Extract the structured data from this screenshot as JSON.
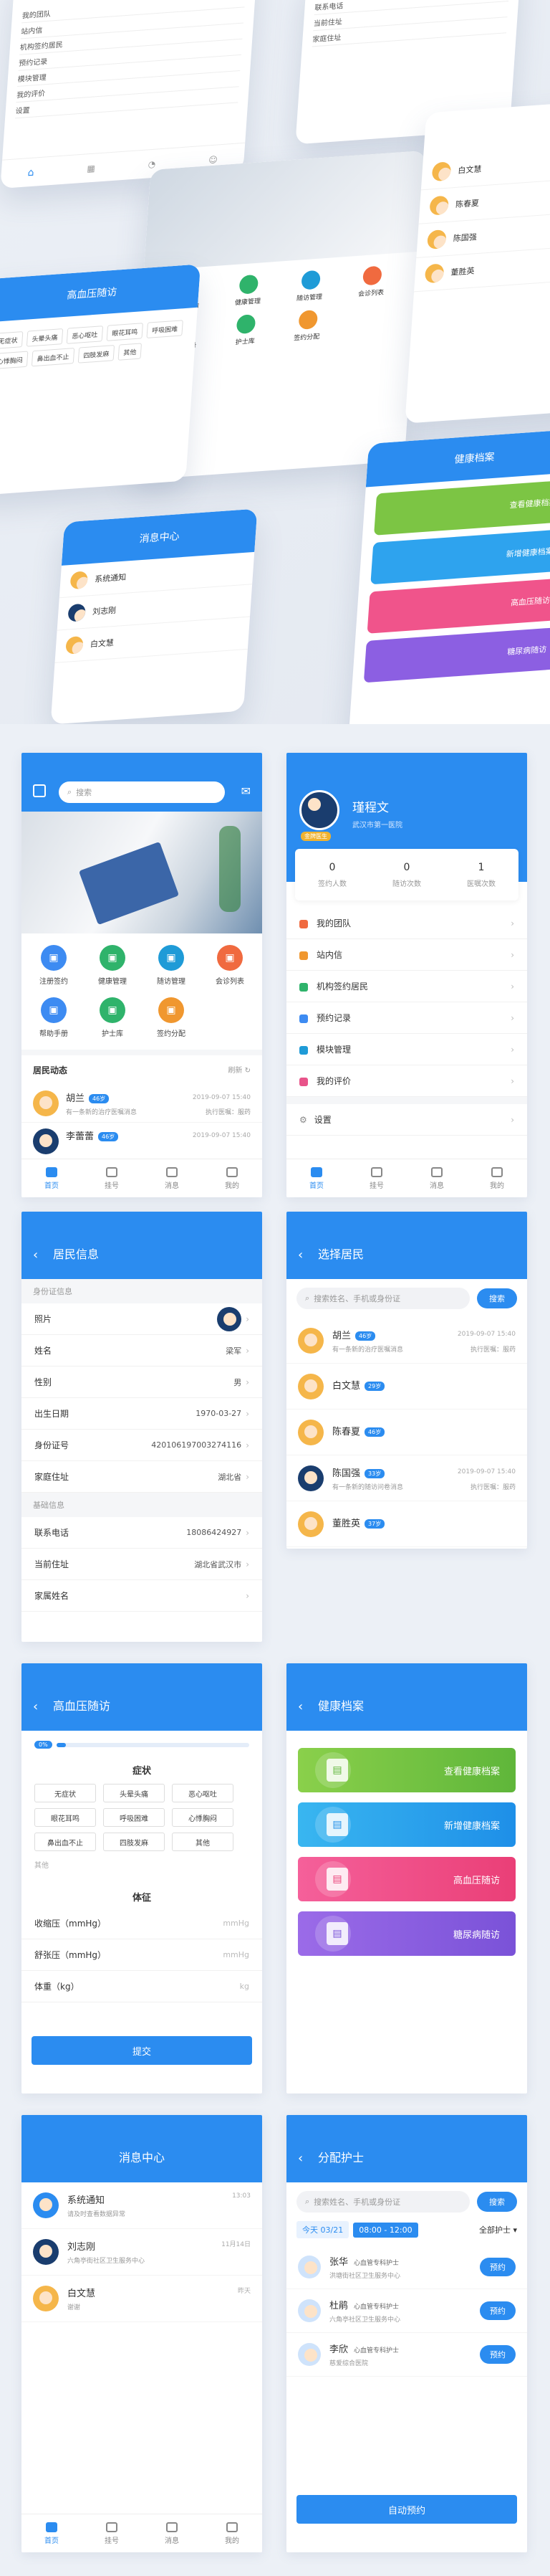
{
  "hero": {
    "a_menu": [
      "我的团队",
      "站内信",
      "机构签约居民",
      "预约记录",
      "模块管理",
      "我的评价",
      "设置"
    ],
    "b_rows": [
      "联系电话",
      "当前住址",
      "家庭住址"
    ],
    "b_phone": "18086424927",
    "c_items": [
      "注册签约",
      "健康管理",
      "随访管理",
      "会诊列表",
      "帮助手册",
      "护士库",
      "签约分配"
    ],
    "d_title": "消息中心",
    "d_msgs": [
      "系统通知",
      "刘志刚",
      "白文慧"
    ],
    "e_title": "健康档案",
    "e_cards": [
      "查看健康档案",
      "新增健康档案",
      "高血压随访",
      "糖尿病随访"
    ],
    "f_title": "高血压随访",
    "f_syms": [
      "无症状",
      "头晕头痛",
      "恶心呕吐",
      "眼花耳鸣",
      "呼吸困难",
      "心悸胸闷",
      "鼻出血不止",
      "四肢发麻",
      "其他"
    ],
    "g_names": [
      "白文慧",
      "陈春夏",
      "陈国强",
      "董胜英"
    ]
  },
  "home": {
    "search": "搜索",
    "grid": [
      {
        "label": "注册签约",
        "color": "#3d8bf2",
        "icon": "id-card-icon"
      },
      {
        "label": "健康管理",
        "color": "#2fb36b",
        "icon": "heart-icon"
      },
      {
        "label": "随访管理",
        "color": "#1f9bd7",
        "icon": "clipboard-icon"
      },
      {
        "label": "会诊列表",
        "color": "#f06a3f",
        "icon": "people-icon"
      },
      {
        "label": "帮助手册",
        "color": "#3d8bf2",
        "icon": "book-icon"
      },
      {
        "label": "护士库",
        "color": "#2fb36b",
        "icon": "nurse-icon"
      },
      {
        "label": "签约分配",
        "color": "#f0972f",
        "icon": "share-icon"
      }
    ],
    "news_title": "居民动态",
    "refresh": "刷新",
    "news": [
      {
        "name": "胡兰",
        "tag": "46岁",
        "time": "2019-09-07 15:40",
        "desc": "有一条新的治疗医嘱消息",
        "action": "执行医嘱：服药",
        "avatar": "f"
      },
      {
        "name": "李蕾蕾",
        "tag": "46岁",
        "time": "2019-09-07 15:40",
        "desc": "",
        "action": "",
        "avatar": "m"
      }
    ]
  },
  "tabs": [
    "首页",
    "挂号",
    "消息",
    "我的"
  ],
  "profile": {
    "name": "瑾程文",
    "org": "武汉市第一医院",
    "badge": "金牌医生",
    "stats": [
      {
        "num": "0",
        "label": "签约人数"
      },
      {
        "num": "0",
        "label": "随访次数"
      },
      {
        "num": "1",
        "label": "医嘱次数"
      }
    ],
    "menu": [
      {
        "label": "我的团队",
        "color": "#f06a3f"
      },
      {
        "label": "站内信",
        "color": "#f0972f"
      },
      {
        "label": "机构签约居民",
        "color": "#2fb36b"
      },
      {
        "label": "预约记录",
        "color": "#3d8bf2"
      },
      {
        "label": "模块管理",
        "color": "#1f9bd7"
      },
      {
        "label": "我的评价",
        "color": "#e8548a"
      }
    ],
    "settings": "设置"
  },
  "resident": {
    "title": "居民信息",
    "sect1": "身份证信息",
    "rows1": [
      {
        "k": "照片",
        "v": ""
      },
      {
        "k": "姓名",
        "v": "梁军"
      },
      {
        "k": "性别",
        "v": "男"
      },
      {
        "k": "出生日期",
        "v": "1970-03-27"
      },
      {
        "k": "身份证号",
        "v": "420106197003274116"
      },
      {
        "k": "家庭住址",
        "v": "湖北省"
      }
    ],
    "sect2": "基础信息",
    "rows2": [
      {
        "k": "联系电话",
        "v": "18086424927"
      },
      {
        "k": "当前住址",
        "v": "湖北省武汉市"
      },
      {
        "k": "家属姓名",
        "v": ""
      }
    ]
  },
  "select": {
    "title": "选择居民",
    "placeholder": "搜索姓名、手机或身份证",
    "btn": "搜索",
    "list": [
      {
        "name": "胡兰",
        "tag": "46岁",
        "desc": "有一条新的治疗医嘱消息",
        "time": "2019-09-07 15:40",
        "action": "执行医嘱：服药",
        "avatar": "f"
      },
      {
        "name": "白文慧",
        "tag": "29岁",
        "desc": "",
        "time": "",
        "action": "",
        "avatar": "f"
      },
      {
        "name": "陈春夏",
        "tag": "46岁",
        "desc": "",
        "time": "",
        "action": "",
        "avatar": "f"
      },
      {
        "name": "陈国强",
        "tag": "33岁",
        "desc": "有一条新的随访问卷消息",
        "time": "2019-09-07 15:40",
        "action": "执行医嘱：服药",
        "avatar": "m"
      },
      {
        "name": "董胜英",
        "tag": "37岁",
        "desc": "",
        "time": "",
        "action": "",
        "avatar": "f"
      }
    ]
  },
  "bp": {
    "title": "高血压随访",
    "progress_label": "0%",
    "progress": 0.05,
    "section": "症状",
    "symptoms": [
      "无症状",
      "头晕头痛",
      "恶心呕吐",
      "眼花耳鸣",
      "呼吸困难",
      "心悸胸闷",
      "鼻出血不止",
      "四肢发麻",
      "其他"
    ],
    "other": "其他",
    "section2": "体征",
    "rows": [
      {
        "k": "收缩压（mmHg）",
        "v": "mmHg"
      },
      {
        "k": "舒张压（mmHg）",
        "v": "mmHg"
      },
      {
        "k": "体重（kg）",
        "v": "kg"
      }
    ],
    "submit": "提交"
  },
  "archive": {
    "title": "健康档案",
    "cards": [
      {
        "label": "查看健康档案",
        "from": "#8ad04b",
        "to": "#5fb63a",
        "icon": "folder-icon"
      },
      {
        "label": "新增健康档案",
        "from": "#39b6f0",
        "to": "#1e8fe8",
        "icon": "add-file-icon"
      },
      {
        "label": "高血压随访",
        "from": "#f5609a",
        "to": "#ea3f77",
        "icon": "thermometer-icon"
      },
      {
        "label": "糖尿病随访",
        "from": "#9b6be8",
        "to": "#7a52d8",
        "icon": "drop-icon"
      }
    ]
  },
  "messages": {
    "title": "消息中心",
    "list": [
      {
        "name": "系统通知",
        "desc": "请及时查看数据异常",
        "time": "13:03",
        "color": "#2b8cf0"
      },
      {
        "name": "刘志刚",
        "desc": "六角亭街社区卫生服务中心",
        "time": "11月14日",
        "color": "#1a3d6e"
      },
      {
        "name": "白文慧",
        "desc": "谢谢",
        "time": "昨天",
        "color": "#f5b64a"
      }
    ]
  },
  "nurse": {
    "title": "分配护士",
    "placeholder": "搜索姓名、手机或身份证",
    "btn": "搜索",
    "date": "今天 03/21",
    "time_slot": "08:00 - 12:00",
    "filter": "全部护士",
    "list": [
      {
        "name": "张华",
        "role": "心血管专科护士",
        "org": "洪塘街社区卫生服务中心",
        "btn": "预约"
      },
      {
        "name": "杜鹃",
        "role": "心血管专科护士",
        "org": "六角亭社区卫生服务中心",
        "btn": "预约"
      },
      {
        "name": "李欣",
        "role": "心血管专科护士",
        "org": "慈爱综合医院",
        "btn": "预约"
      }
    ],
    "auto": "自动预约"
  }
}
